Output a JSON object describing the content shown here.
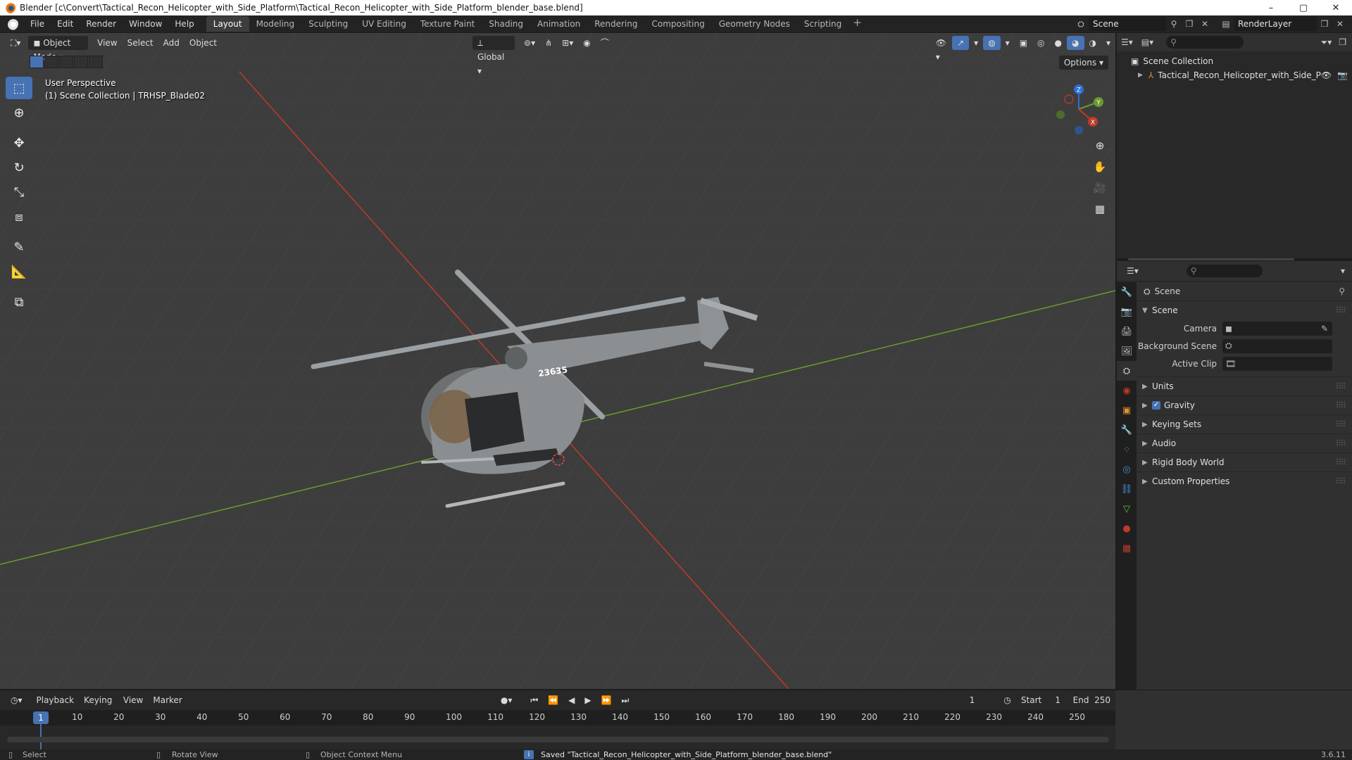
{
  "window": {
    "title": "Blender [c\\Convert\\Tactical_Recon_Helicopter_with_Side_Platform\\Tactical_Recon_Helicopter_with_Side_Platform_blender_base.blend]",
    "controls": [
      "–",
      "▢",
      "✕"
    ]
  },
  "menu": {
    "items": [
      "File",
      "Edit",
      "Render",
      "Window",
      "Help"
    ],
    "workspaces": [
      "Layout",
      "Modeling",
      "Sculpting",
      "UV Editing",
      "Texture Paint",
      "Shading",
      "Animation",
      "Rendering",
      "Compositing",
      "Geometry Nodes",
      "Scripting"
    ],
    "active_workspace": "Layout",
    "add_workspace": "+",
    "scene": "Scene",
    "view_layer": "RenderLayer"
  },
  "viewport": {
    "mode": "Object Mode",
    "menus": [
      "View",
      "Select",
      "Add",
      "Object"
    ],
    "transform_orientation": "Global",
    "options_label": "Options",
    "perspective_label": "User Perspective",
    "collection_label": "(1) Scene Collection | TRHSP_Blade02",
    "tail_number": "23635",
    "gizmo_axes": [
      "X",
      "Y",
      "Z"
    ],
    "tools": [
      "select-box-icon",
      "cursor-icon",
      "move-icon",
      "rotate-icon",
      "scale-icon",
      "transform-icon",
      "annotate-icon",
      "measure-icon",
      "add-cube-icon"
    ]
  },
  "outliner": {
    "root": "Scene Collection",
    "items": [
      "Tactical_Recon_Helicopter_with_Side_P"
    ]
  },
  "properties": {
    "title": "Scene",
    "section": "Scene",
    "fields": [
      {
        "label": "Camera",
        "value": ""
      },
      {
        "label": "Background Scene",
        "value": ""
      },
      {
        "label": "Active Clip",
        "value": ""
      }
    ],
    "panels": [
      "Units",
      "Gravity",
      "Keying Sets",
      "Audio",
      "Rigid Body World",
      "Custom Properties"
    ],
    "gravity_enabled": true
  },
  "timeline": {
    "menus": [
      "Playback",
      "Keying",
      "View",
      "Marker"
    ],
    "current_frame": "1",
    "start_label": "Start",
    "start": "1",
    "end_label": "End",
    "end": "250",
    "frame_ticks": [
      "10",
      "20",
      "30",
      "40",
      "50",
      "60",
      "70",
      "80",
      "90",
      "100",
      "110",
      "120",
      "130",
      "140",
      "150",
      "160",
      "170",
      "180",
      "190",
      "200",
      "210",
      "220",
      "230",
      "240",
      "250"
    ]
  },
  "statusbar": {
    "select": "Select",
    "rotate": "Rotate View",
    "context": "Object Context Menu",
    "message": "Saved \"Tactical_Recon_Helicopter_with_Side_Platform_blender_base.blend\"",
    "version": "3.6.11"
  },
  "colors": {
    "accent": "#4772b3",
    "x_axis": "#c0392b",
    "y_axis": "#6b9a2e",
    "viewport_bg": "#3d3d3d"
  }
}
